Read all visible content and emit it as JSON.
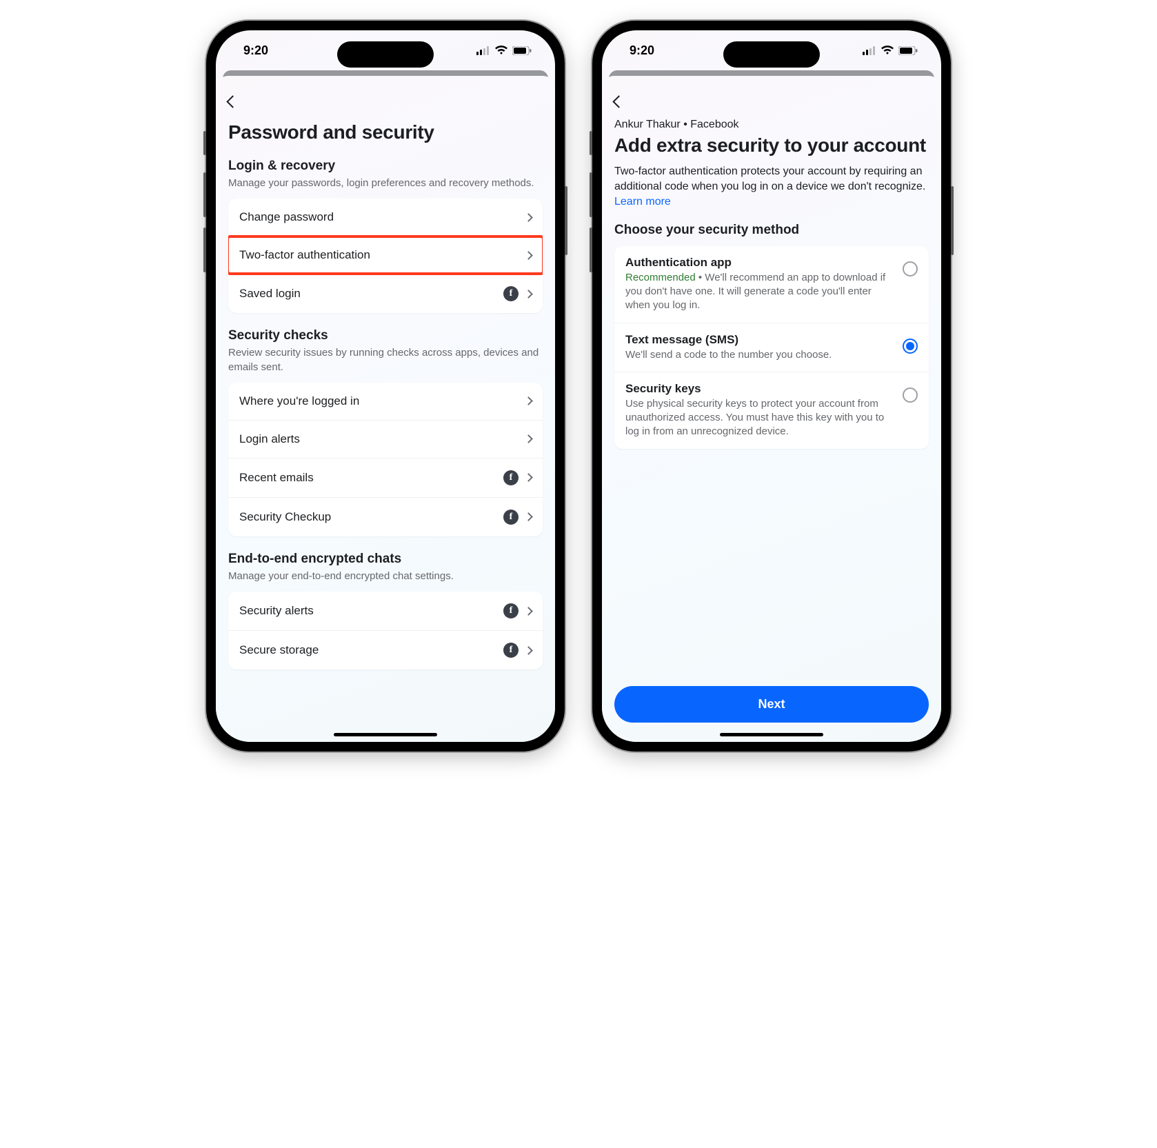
{
  "status": {
    "time": "9:20"
  },
  "screen1": {
    "title": "Password and security",
    "sections": [
      {
        "title": "Login & recovery",
        "desc": "Manage your passwords, login preferences and recovery methods.",
        "items": [
          {
            "label": "Change password",
            "fb": false,
            "highlight": false
          },
          {
            "label": "Two-factor authentication",
            "fb": false,
            "highlight": true
          },
          {
            "label": "Saved login",
            "fb": true,
            "highlight": false
          }
        ]
      },
      {
        "title": "Security checks",
        "desc": "Review security issues by running checks across apps, devices and emails sent.",
        "items": [
          {
            "label": "Where you're logged in",
            "fb": false
          },
          {
            "label": "Login alerts",
            "fb": false
          },
          {
            "label": "Recent emails",
            "fb": true
          },
          {
            "label": "Security Checkup",
            "fb": true
          }
        ]
      },
      {
        "title": "End-to-end encrypted chats",
        "desc": "Manage your end-to-end encrypted chat settings.",
        "items": [
          {
            "label": "Security alerts",
            "fb": true
          },
          {
            "label": "Secure storage",
            "fb": true
          }
        ]
      }
    ]
  },
  "screen2": {
    "breadcrumb": "Ankur Thakur • Facebook",
    "title": "Add extra security to your account",
    "body_pre": "Two-factor authentication protects your account by requiring an additional code when you log in on a device we don't recognize. ",
    "learn_more": "Learn more",
    "choose_label": "Choose your security method",
    "methods": [
      {
        "title": "Authentication app",
        "recommended": "Recommended",
        "desc_after": " • We'll recommend an app to download if you don't have one. It will generate a code you'll enter when you log in.",
        "selected": false
      },
      {
        "title": "Text message (SMS)",
        "desc": "We'll send a code to the number you choose.",
        "selected": true
      },
      {
        "title": "Security keys",
        "desc": "Use physical security keys to protect your account from unauthorized access. You must have this key with you to log in from an unrecognized device.",
        "selected": false
      }
    ],
    "next_label": "Next"
  }
}
